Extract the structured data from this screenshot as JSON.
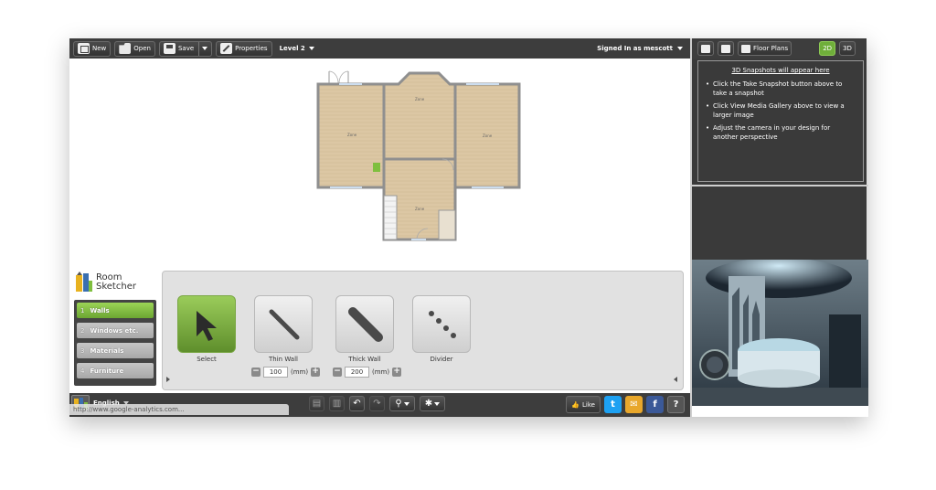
{
  "toolbar": {
    "new_label": "New",
    "open_label": "Open",
    "save_label": "Save",
    "properties_label": "Properties",
    "level_label": "Level 2",
    "signed_in_label": "Signed In as mescott"
  },
  "right_panel": {
    "floor_plans_label": "Floor Plans",
    "mode_2d": "2D",
    "mode_3d": "3D",
    "snapshot_title": "3D Snapshots will appear here",
    "tips": [
      "Click the Take Snapshot button above to take a snapshot",
      "Click View Media Gallery above to view a larger image",
      "Adjust the camera in your design for another perspective"
    ]
  },
  "floorplan": {
    "room_labels": [
      "Zone",
      "Zone",
      "Zone",
      "Zone"
    ]
  },
  "logo": {
    "line1": "Room",
    "line2": "Sketcher"
  },
  "steps": [
    {
      "num": "1",
      "label": "Walls"
    },
    {
      "num": "2",
      "label": "Windows etc."
    },
    {
      "num": "3",
      "label": "Materials"
    },
    {
      "num": "4",
      "label": "Furniture"
    }
  ],
  "tools": {
    "select_label": "Select",
    "thin_wall_label": "Thin Wall",
    "thick_wall_label": "Thick Wall",
    "divider_label": "Divider",
    "thin_wall_value": "100",
    "thick_wall_value": "200",
    "unit": "(mm)"
  },
  "bottombar": {
    "language": "English",
    "status_url": "http://www.google-analytics.com...",
    "like_label": "Like"
  },
  "colors": {
    "accent_green": "#6fae3a",
    "toolbar_bg": "#3d3d3d",
    "twitter": "#1da1f2",
    "facebook": "#3b5998",
    "email": "#e8a72b"
  }
}
